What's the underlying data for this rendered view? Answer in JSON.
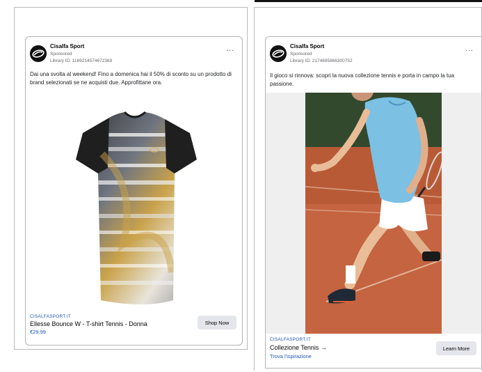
{
  "ads": [
    {
      "advertiser": "Cisalfa Sport",
      "sponsored": "Sponsored",
      "library_id": "Library ID: 1169214574672369",
      "more": "···",
      "body": "Dai una svolta al weekend! Fino a domenica hai il 50% di sconto su un prodotto di brand selezionati se ne acquisti due. Approfittane ora.",
      "domain": "CISALFASPORT.IT",
      "title": "Ellesse Bounce W - T-shirt Tennis - Donna",
      "subtitle": "€29.99",
      "button": "Shop Now",
      "media": "t-shirt-image"
    },
    {
      "advertiser": "Cisalfa Sport",
      "sponsored": "Sponsored",
      "library_id": "Library ID: 2174895866300752",
      "more": "···",
      "body": "Il gioco si rinnova: scopri la nuova collezione tennis e porta in campo la tua passione.",
      "domain": "CISALFASPORT.IT",
      "title": "Collezione Tennis →",
      "subtitle": "Trova l'ispirazione",
      "button": "Learn More",
      "media": "tennis-player-photo"
    }
  ]
}
